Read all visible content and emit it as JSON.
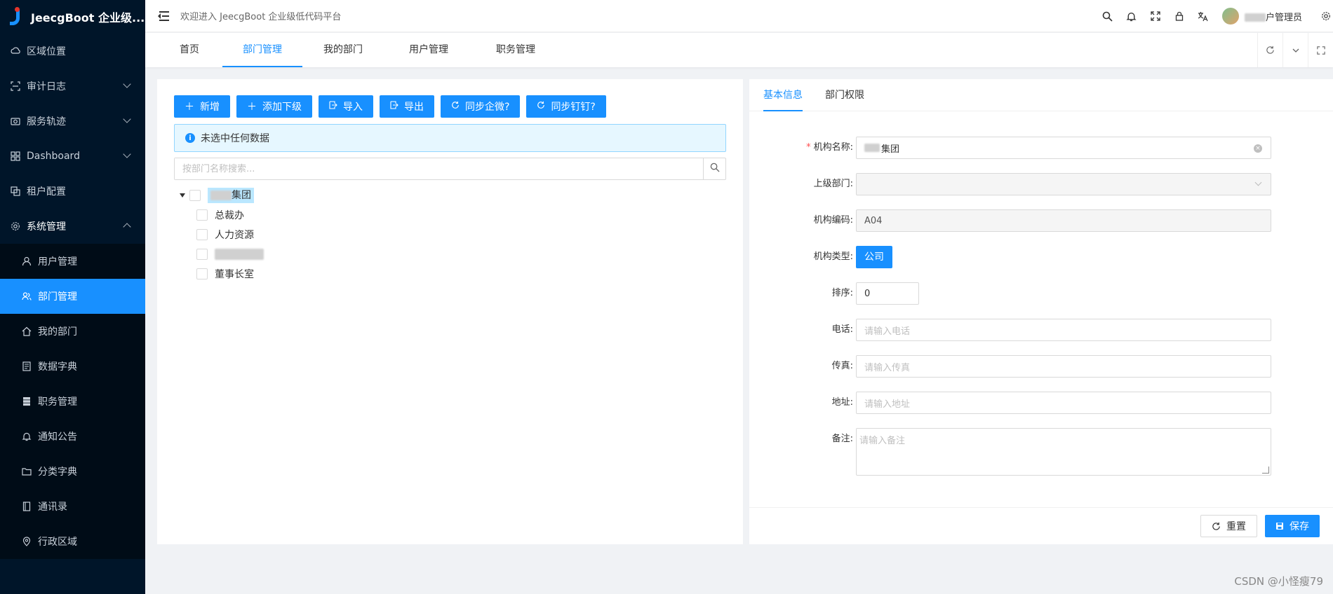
{
  "app": {
    "title": "JeecgBoot 企业级...",
    "welcome": "欢迎进入 JeecgBoot 企业级低代码平台",
    "user_name_suffix": "户管理员"
  },
  "sidebar": {
    "items": [
      {
        "label": "区域位置",
        "icon": "cloud-icon"
      },
      {
        "label": "审计日志",
        "icon": "scan-icon"
      },
      {
        "label": "服务轨迹",
        "icon": "camera-icon"
      },
      {
        "label": "Dashboard",
        "icon": "grid-icon"
      },
      {
        "label": "租户配置",
        "icon": "copy-icon"
      },
      {
        "label": "系统管理",
        "icon": "gear-icon"
      }
    ],
    "submenu": [
      {
        "label": "用户管理",
        "icon": "user-icon"
      },
      {
        "label": "部门管理",
        "icon": "team-icon"
      },
      {
        "label": "我的部门",
        "icon": "home-icon"
      },
      {
        "label": "数据字典",
        "icon": "book-icon"
      },
      {
        "label": "职务管理",
        "icon": "database-icon"
      },
      {
        "label": "通知公告",
        "icon": "bell-icon"
      },
      {
        "label": "分类字典",
        "icon": "folder-icon"
      },
      {
        "label": "通讯录",
        "icon": "contacts-icon"
      },
      {
        "label": "行政区域",
        "icon": "location-icon"
      }
    ]
  },
  "tabs": [
    "首页",
    "部门管理",
    "我的部门",
    "用户管理",
    "职务管理"
  ],
  "toolbar": {
    "add": "新增",
    "add_child": "添加下级",
    "import": "导入",
    "export": "导出",
    "sync_wechat": "同步企微?",
    "sync_dingtalk": "同步钉钉?"
  },
  "alert": "未选中任何数据",
  "search": {
    "placeholder": "按部门名称搜索..."
  },
  "tree": {
    "root_suffix": "集团",
    "children": [
      "总裁办",
      "人力资源",
      "",
      "董事长室"
    ]
  },
  "detail_tabs": [
    "基本信息",
    "部门权限"
  ],
  "form": {
    "org_name_label": "机构名称:",
    "org_name_suffix": "集团",
    "parent_label": "上级部门:",
    "code_label": "机构编码:",
    "code_value": "A04",
    "type_label": "机构类型:",
    "type_value": "公司",
    "order_label": "排序:",
    "order_value": "0",
    "phone_label": "电话:",
    "phone_placeholder": "请输入电话",
    "fax_label": "传真:",
    "fax_placeholder": "请输入传真",
    "address_label": "地址:",
    "address_placeholder": "请输入地址",
    "memo_label": "备注:",
    "memo_placeholder": "请输入备注",
    "reset": "重置",
    "save": "保存"
  },
  "watermark": "CSDN @小怪瘦79",
  "colors": {
    "primary": "#1890ff",
    "sidebar": "#001529",
    "sidebar_sub": "#000c17"
  }
}
